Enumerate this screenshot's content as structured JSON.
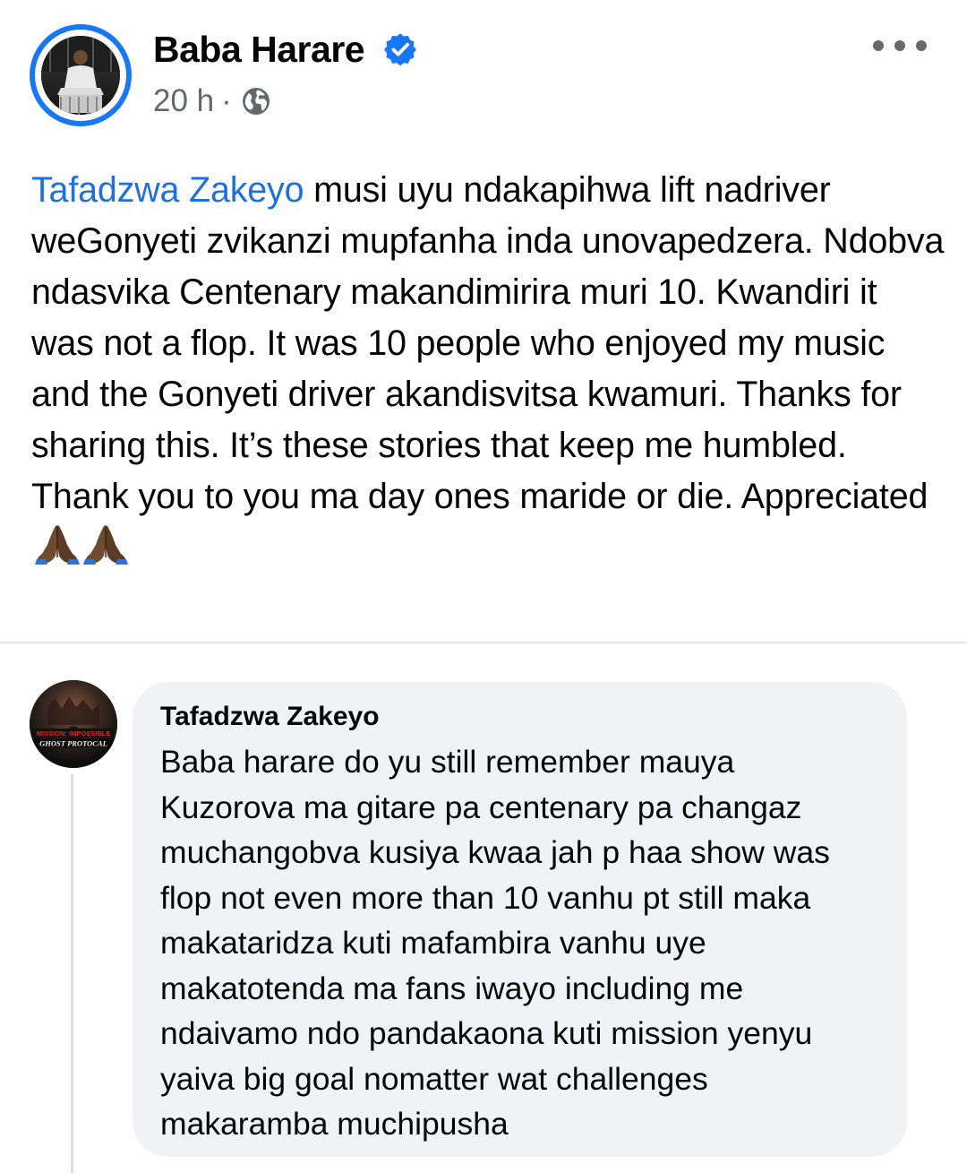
{
  "post": {
    "author": "Baba Harare",
    "time": "20 h",
    "meta_separator": "·",
    "icons": {
      "verified": "verified-badge-icon",
      "audience": "globe-icon",
      "more": "more-options-icon"
    },
    "mention": "Tafadzwa Zakeyo",
    "body": " musi uyu ndakapihwa lift nadriver weGonyeti zvikanzi mupfanha inda unovapedzera. Ndobva ndasvika Centenary makandimirira muri 10. Kwandiri it was not a flop. It was 10 people who enjoyed my music and the Gonyeti driver akandisvitsa kwamuri. Thanks for sharing this. It’s these stories that keep me humbled. Thank you to you ma day ones maride or die. Appreciated ",
    "emoji": [
      "folded-hands-emoji",
      "folded-hands-emoji"
    ]
  },
  "comment": {
    "author": "Tafadzwa Zakeyo",
    "avatar_text": [
      "MISSION: IMPOSSIBLE",
      "GHOST PROTOCAL"
    ],
    "lines": [
      "Baba harare do yu still remember  mauya",
      "Kuzorova ma gitare  pa centenary pa changaz",
      "muchangobva kusiya kwaa jah p haa show was",
      "flop not even more than 10 vanhu pt still maka",
      "makataridza kuti mafambira vanhu uye",
      "makatotenda ma fans iwayo including me",
      "ndaivamo ndo pandakaona kuti mission yenyu",
      "yaiva big goal nomatter wat challenges",
      "makaramba muchipusha"
    ]
  },
  "colors": {
    "verified_blue": "#1877f2",
    "link_blue": "#216fdb",
    "meta_gray": "#65676b",
    "bubble_gray": "#f0f2f5"
  }
}
